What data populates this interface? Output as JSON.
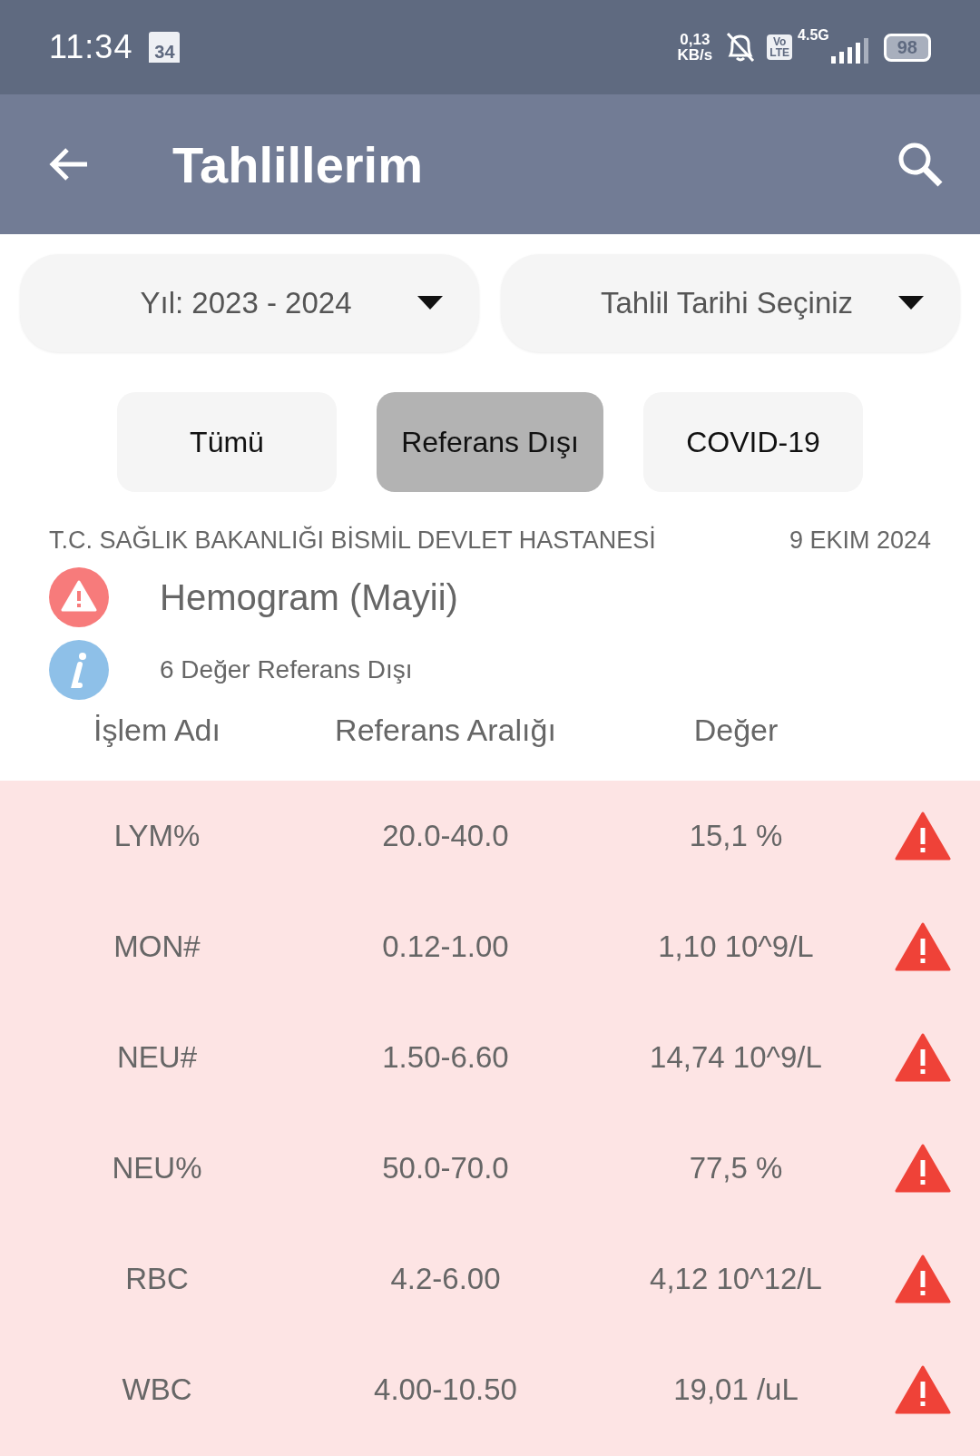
{
  "status_bar": {
    "time": "11:34",
    "calendar_day": "34",
    "speed_value": "0,13",
    "speed_unit": "KB/s",
    "volte_top": "Vo",
    "volte_bottom": "LTE",
    "network": "4.5G",
    "battery": "98"
  },
  "app_bar": {
    "title": "Tahlillerim"
  },
  "filters": [
    {
      "label": "Yıl: 2023 - 2024"
    },
    {
      "label": "Tahlil Tarihi Seçiniz"
    }
  ],
  "tabs": [
    {
      "label": "Tümü",
      "selected": false
    },
    {
      "label": "Referans Dışı",
      "selected": true
    },
    {
      "label": "COVID-19",
      "selected": false
    }
  ],
  "result": {
    "hospital": "T.C. SAĞLIK BAKANLIĞI BİSMİL DEVLET HASTANESİ",
    "date": "9 EKIM 2024",
    "test_name": "Hemogram (Mayii)",
    "summary": "6 Değer Referans Dışı"
  },
  "table": {
    "columns": [
      "İşlem Adı",
      "Referans Aralığı",
      "Değer"
    ],
    "rows": [
      {
        "name": "LYM%",
        "range": "20.0-40.0",
        "value": "15,1 %",
        "out_of_range": true
      },
      {
        "name": "MON#",
        "range": "0.12-1.00",
        "value": "1,10 10^9/L",
        "out_of_range": true
      },
      {
        "name": "NEU#",
        "range": "1.50-6.60",
        "value": "14,74 10^9/L",
        "out_of_range": true
      },
      {
        "name": "NEU%",
        "range": "50.0-70.0",
        "value": "77,5 %",
        "out_of_range": true
      },
      {
        "name": "RBC",
        "range": "4.2-6.00",
        "value": "4,12 10^12/L",
        "out_of_range": true
      },
      {
        "name": "WBC",
        "range": "4.00-10.50",
        "value": "19,01 /uL",
        "out_of_range": true
      }
    ]
  }
}
